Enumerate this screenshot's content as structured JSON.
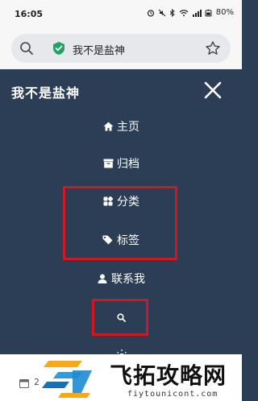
{
  "status_bar": {
    "time": "16:05",
    "battery": "80%"
  },
  "browser": {
    "url_text": "我不是盐神"
  },
  "nav": {
    "site_title": "我不是盐神",
    "items": [
      {
        "label": "主页",
        "icon": "home-icon"
      },
      {
        "label": "归档",
        "icon": "archive-icon"
      },
      {
        "label": "分类",
        "icon": "category-icon"
      },
      {
        "label": "标签",
        "icon": "tag-icon"
      },
      {
        "label": "联系我",
        "icon": "user-icon"
      },
      {
        "label": "",
        "icon": "search-icon"
      }
    ]
  },
  "footer": {
    "date_partial": "2"
  },
  "watermark": {
    "name": "飞拓攻略网",
    "url": "fiytounicont.com"
  },
  "colors": {
    "panel_bg": "#2c3e55",
    "highlight": "#d2171f",
    "shield": "#1fa463"
  }
}
